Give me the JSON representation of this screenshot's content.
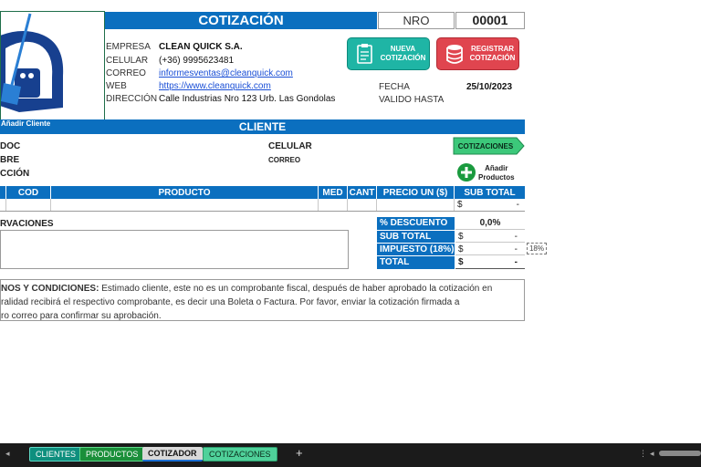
{
  "header": {
    "title": "COTIZACIÓN",
    "nro_label": "NRO",
    "nro_value": "00001"
  },
  "company": {
    "empresa_label": "EMPRESA",
    "empresa_value": "CLEAN QUICK S.A.",
    "celular_label": "CELULAR",
    "celular_value": "(+36) 9995623481",
    "correo_label": "CORREO",
    "correo_value": "informesventas@cleanquick.com",
    "web_label": "WEB",
    "web_value": "https://www.cleanquick.com",
    "direccion_label": "DIRECCIÓN",
    "direccion_value": "Calle Industrias Nro 123 Urb. Las Gondolas"
  },
  "meta": {
    "fecha_label": "FECHA",
    "fecha_value": "25/10/2023",
    "valido_label": "VALIDO HASTA",
    "valido_value": ""
  },
  "buttons": {
    "nueva_cotizacion": "NUEVA\nCOTIZACIÓN",
    "registrar_cotizacion": "REGISTRAR\nCOTIZACIÓN",
    "cotizaciones": "COTIZACIONES",
    "anadir_cliente": "Añadir Cliente",
    "anadir_productos": "Añadir\nProductos"
  },
  "client": {
    "section_title": "CLIENTE",
    "doc_label": "DOC",
    "nombre_label": "BRE",
    "direccion_label": "CCIÓN",
    "celular_label": "CELULAR",
    "correo_label": "CORREO"
  },
  "products_table": {
    "columns": [
      "COD",
      "PRODUCTO",
      "MED",
      "CANT",
      "PRECIO UN ($)",
      "SUB TOTAL"
    ],
    "rows": [
      {
        "cod": "",
        "producto": "",
        "med": "",
        "cant": "",
        "precio": "",
        "currency": "$",
        "subtotal": "-"
      }
    ]
  },
  "observaciones": {
    "label": "RVACIONES"
  },
  "totals": {
    "descuento_label": "% DESCUENTO",
    "descuento_value": "0,0%",
    "subtotal_label": "SUB TOTAL",
    "subtotal_currency": "$",
    "subtotal_value": "-",
    "impuesto_label": "IMPUESTO (18%)",
    "impuesto_currency": "$",
    "impuesto_value": "-",
    "impuesto_rate": "18%",
    "total_label": "TOTAL",
    "total_currency": "$",
    "total_value": "-"
  },
  "terms": {
    "heading": "NOS Y CONDICIONES:",
    "line1": " Estimado cliente, este no es un comprobante fiscal, después de haber aprobado la cotización en",
    "line2": "ralidad recibirá el respectivo comprobante, es decir una Boleta o Factura. Por favor, enviar la cotización firmada a",
    "line3": "ro correo para confirmar su aprobación."
  },
  "sheet_tabs": [
    {
      "label": "CLIENTES",
      "color": "#0e8f7e"
    },
    {
      "label": "PRODUCTOS",
      "color": "#1a8f3a"
    },
    {
      "label": "COTIZADOR",
      "color": "#d9d9d9"
    },
    {
      "label": "COTIZACIONES",
      "color": "#4fd19a"
    }
  ],
  "add_sheet": "+",
  "colors": {
    "primary_blue": "#0b6fbf",
    "teal_button": "#1fb5a5",
    "red_button": "#e0454f",
    "green_button": "#3cc87a"
  }
}
